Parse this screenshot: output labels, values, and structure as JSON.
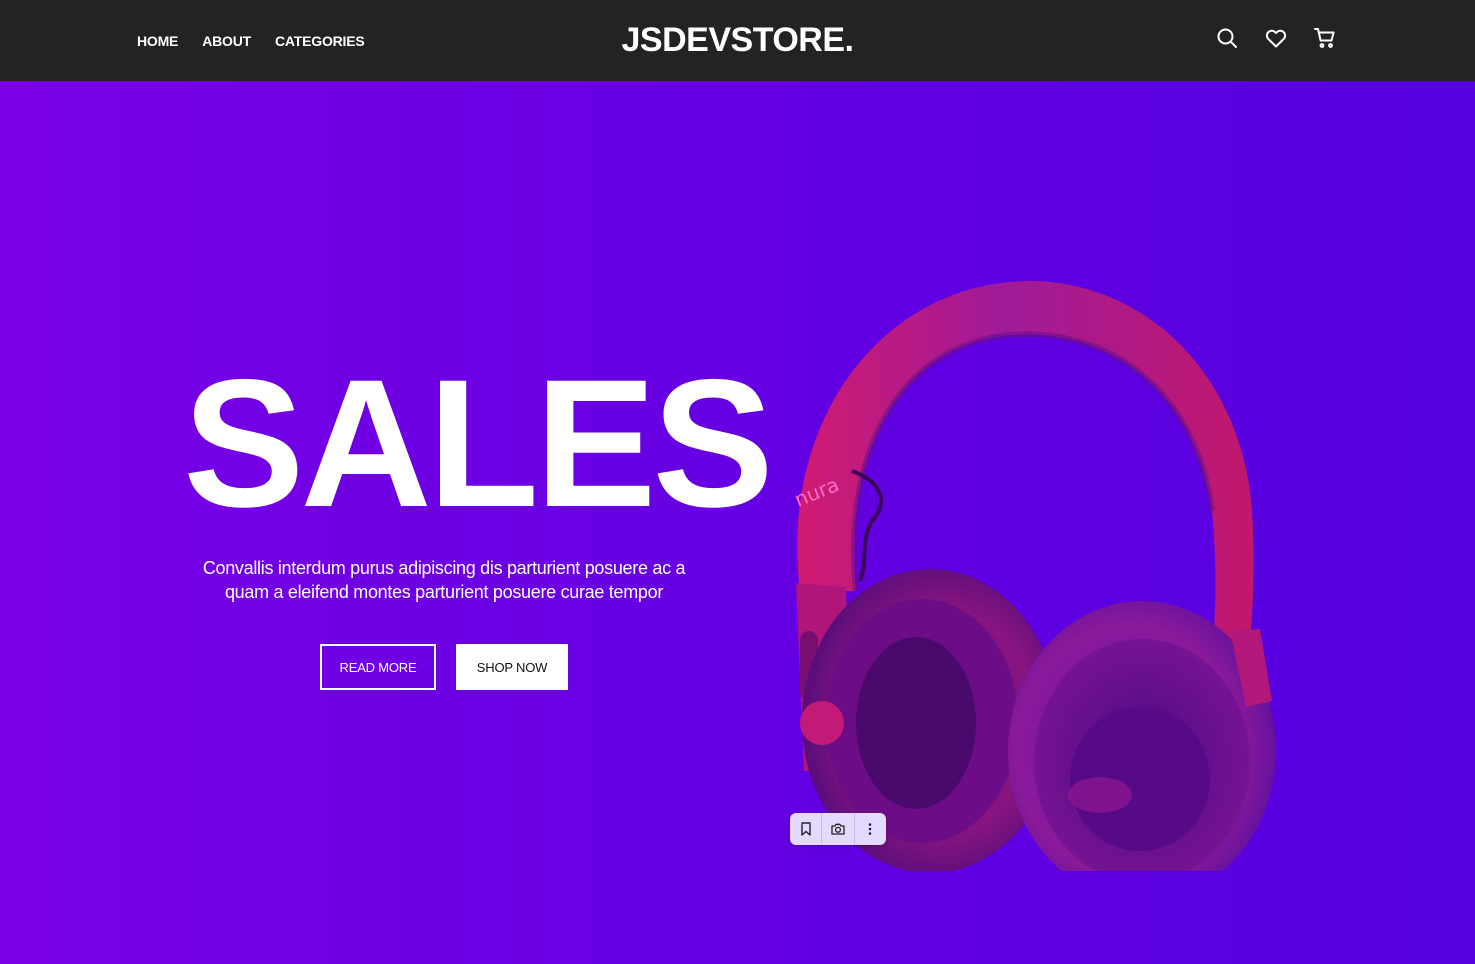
{
  "header": {
    "nav": [
      "HOME",
      "ABOUT",
      "CATEGORIES"
    ],
    "brand": "JSDEVSTORE.",
    "icons": [
      "search-icon",
      "heart-icon",
      "cart-icon"
    ]
  },
  "hero": {
    "title": "SALES",
    "subtitle_line1": "Convallis interdum purus adipiscing dis parturient posuere ac a",
    "subtitle_line2": "quam a eleifend montes parturient posuere curae tempor",
    "read_more_label": "READ MORE",
    "shop_now_label": "SHOP NOW",
    "product_brand": "nura"
  },
  "image_toolbar": {
    "icons": [
      "bookmark-icon",
      "camera-icon",
      "more-vertical-icon"
    ]
  },
  "colors": {
    "header_bg": "#232323",
    "hero_left": "#7a00e6",
    "hero_right": "#5400e0",
    "headphone_pink": "#c4186e",
    "text": "#ffffff"
  }
}
